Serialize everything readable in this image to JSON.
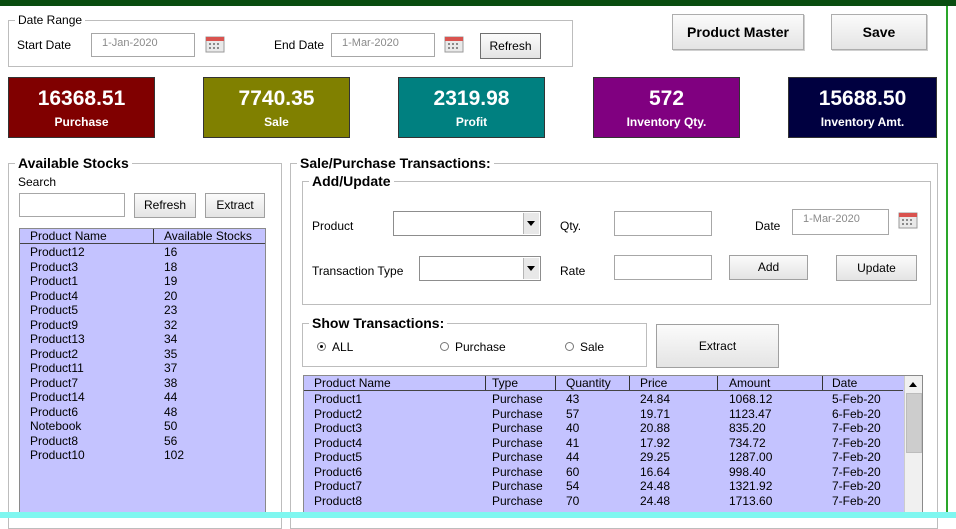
{
  "date_range": {
    "legend": "Date Range",
    "start_label": "Start Date",
    "start_value": "1-Jan-2020",
    "end_label": "End Date",
    "end_value": "1-Mar-2020",
    "refresh": "Refresh"
  },
  "buttons": {
    "product_master": "Product Master",
    "save": "Save"
  },
  "kpis": [
    {
      "value": "16368.51",
      "label": "Purchase",
      "color": "#800000"
    },
    {
      "value": "7740.35",
      "label": "Sale",
      "color": "#808000"
    },
    {
      "value": "2319.98",
      "label": "Profit",
      "color": "#008080"
    },
    {
      "value": "572",
      "label": "Inventory Qty.",
      "color": "#800080"
    },
    {
      "value": "15688.50",
      "label": "Inventory Amt.",
      "color": "#000040"
    }
  ],
  "stocks": {
    "legend": "Available Stocks",
    "search_label": "Search",
    "search_value": "",
    "refresh": "Refresh",
    "extract": "Extract",
    "columns": [
      "Product Name",
      "Available Stocks"
    ],
    "rows": [
      [
        "Product12",
        "16"
      ],
      [
        "Product3",
        "18"
      ],
      [
        "Product1",
        "19"
      ],
      [
        "Product4",
        "20"
      ],
      [
        "Product5",
        "23"
      ],
      [
        "Product9",
        "32"
      ],
      [
        "Product13",
        "34"
      ],
      [
        "Product2",
        "35"
      ],
      [
        "Product11",
        "37"
      ],
      [
        "Product7",
        "38"
      ],
      [
        "Product14",
        "44"
      ],
      [
        "Product6",
        "48"
      ],
      [
        "Notebook",
        "50"
      ],
      [
        "Product8",
        "56"
      ],
      [
        "Product10",
        "102"
      ]
    ]
  },
  "transactions": {
    "legend": "Sale/Purchase Transactions:",
    "add_legend": "Add/Update",
    "product_label": "Product",
    "qty_label": "Qty.",
    "date_label": "Date",
    "date_value": "1-Mar-2020",
    "type_label": "Transaction Type",
    "rate_label": "Rate",
    "add": "Add",
    "update": "Update",
    "show_legend": "Show Transactions:",
    "radio_all": "ALL",
    "radio_purchase": "Purchase",
    "radio_sale": "Sale",
    "extract": "Extract",
    "columns": [
      "Product Name",
      "Type",
      "Quantity",
      "Price",
      "Amount",
      "Date"
    ],
    "rows": [
      [
        "Product1",
        "Purchase",
        "43",
        "24.84",
        "1068.12",
        "5-Feb-20"
      ],
      [
        "Product2",
        "Purchase",
        "57",
        "19.71",
        "1123.47",
        "6-Feb-20"
      ],
      [
        "Product3",
        "Purchase",
        "40",
        "20.88",
        "835.20",
        "7-Feb-20"
      ],
      [
        "Product4",
        "Purchase",
        "41",
        "17.92",
        "734.72",
        "7-Feb-20"
      ],
      [
        "Product5",
        "Purchase",
        "44",
        "29.25",
        "1287.00",
        "7-Feb-20"
      ],
      [
        "Product6",
        "Purchase",
        "60",
        "16.64",
        "998.40",
        "7-Feb-20"
      ],
      [
        "Product7",
        "Purchase",
        "54",
        "24.48",
        "1321.92",
        "7-Feb-20"
      ],
      [
        "Product8",
        "Purchase",
        "70",
        "24.48",
        "1713.60",
        "7-Feb-20"
      ]
    ]
  }
}
